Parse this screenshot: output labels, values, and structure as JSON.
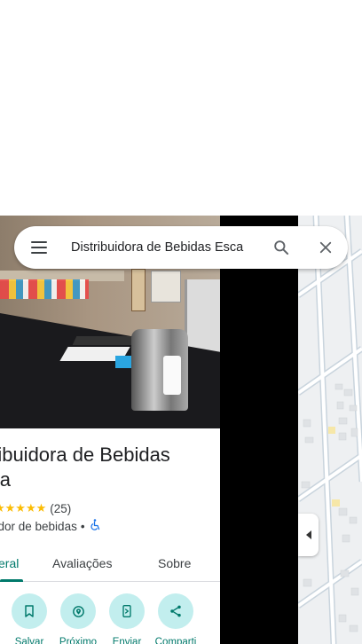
{
  "search": {
    "value": "Distribuidora de Bebidas Esca",
    "menu_icon": "menu-icon",
    "search_icon": "search-icon",
    "close_icon": "close-icon"
  },
  "place": {
    "title_line1": "ribuidora de Bebidas",
    "title_line2": "lla",
    "stars": "★★★★★",
    "rating_count": "(25)",
    "category": "edor de bebidas",
    "separator": "•",
    "accessibility_icon": "wheelchair-icon"
  },
  "tabs": [
    {
      "label": "eral",
      "active": true
    },
    {
      "label": "Avaliações",
      "active": false
    },
    {
      "label": "Sobre",
      "active": false
    }
  ],
  "actions": [
    {
      "label": "Salvar",
      "icon": "bookmark-icon"
    },
    {
      "label": "Próximo",
      "icon": "nearby-icon"
    },
    {
      "label": "Enviar",
      "icon": "send-to-phone-icon"
    },
    {
      "label": "Comparti",
      "icon": "share-icon"
    }
  ],
  "colors": {
    "accent": "#00796b",
    "action_bg": "#c2eeee",
    "star": "#fbbc04",
    "link_blue": "#1a73e8"
  }
}
